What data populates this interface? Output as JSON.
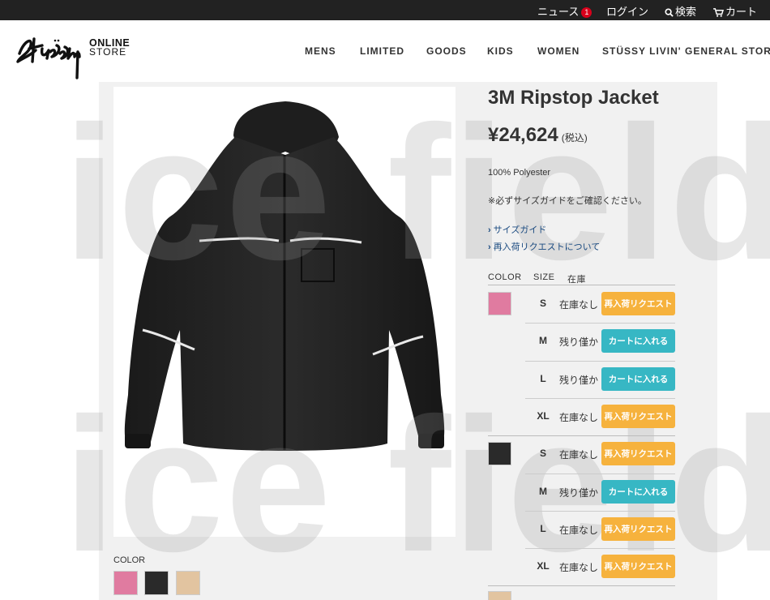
{
  "topbar": {
    "news": "ニュース",
    "news_badge": "1",
    "login": "ログイン",
    "search": "検索",
    "cart": "カート"
  },
  "header": {
    "logo": "Stüssy",
    "online_line1": "ONLINE",
    "online_line2": "STORE",
    "nav": [
      "MENS",
      "LIMITED",
      "GOODS",
      "KIDS",
      "WOMEN",
      "STÜSSY LIVIN' GENERAL STORE"
    ]
  },
  "watermark": {
    "line1": "ice field",
    "line2": "ice field"
  },
  "product": {
    "title": "3M Ripstop Jacket",
    "price": "¥24,624",
    "tax_note": "(税込)",
    "material": "100% Polyester",
    "size_note": "※必ずサイズガイドをご確認ください。",
    "link_size_guide": "サイズガイド",
    "link_restock": "再入荷リクエストについて",
    "table_head": {
      "color": "COLOR",
      "size": "SIZE",
      "stock": "在庫"
    },
    "rows": [
      {
        "size": "S",
        "stock": "在庫なし",
        "button": "再入荷リクエスト",
        "type": "req"
      },
      {
        "size": "M",
        "stock": "残り僅か",
        "button": "カートに入れる",
        "type": "cart"
      },
      {
        "size": "L",
        "stock": "残り僅か",
        "button": "カートに入れる",
        "type": "cart"
      },
      {
        "size": "XL",
        "stock": "在庫なし",
        "button": "再入荷リクエスト",
        "type": "req"
      },
      {
        "size": "S",
        "stock": "在庫なし",
        "button": "再入荷リクエスト",
        "type": "req"
      },
      {
        "size": "M",
        "stock": "残り僅か",
        "button": "カートに入れる",
        "type": "cart"
      },
      {
        "size": "L",
        "stock": "在庫なし",
        "button": "再入荷リクエスト",
        "type": "req"
      },
      {
        "size": "XL",
        "stock": "在庫なし",
        "button": "再入荷リクエスト",
        "type": "req"
      }
    ],
    "colors": [
      "#e07ba0",
      "#2a2a2a",
      "#e2c4a0"
    ],
    "color_label": "COLOR",
    "accent_request": "#f6b23d",
    "accent_cart": "#37b7c4"
  }
}
